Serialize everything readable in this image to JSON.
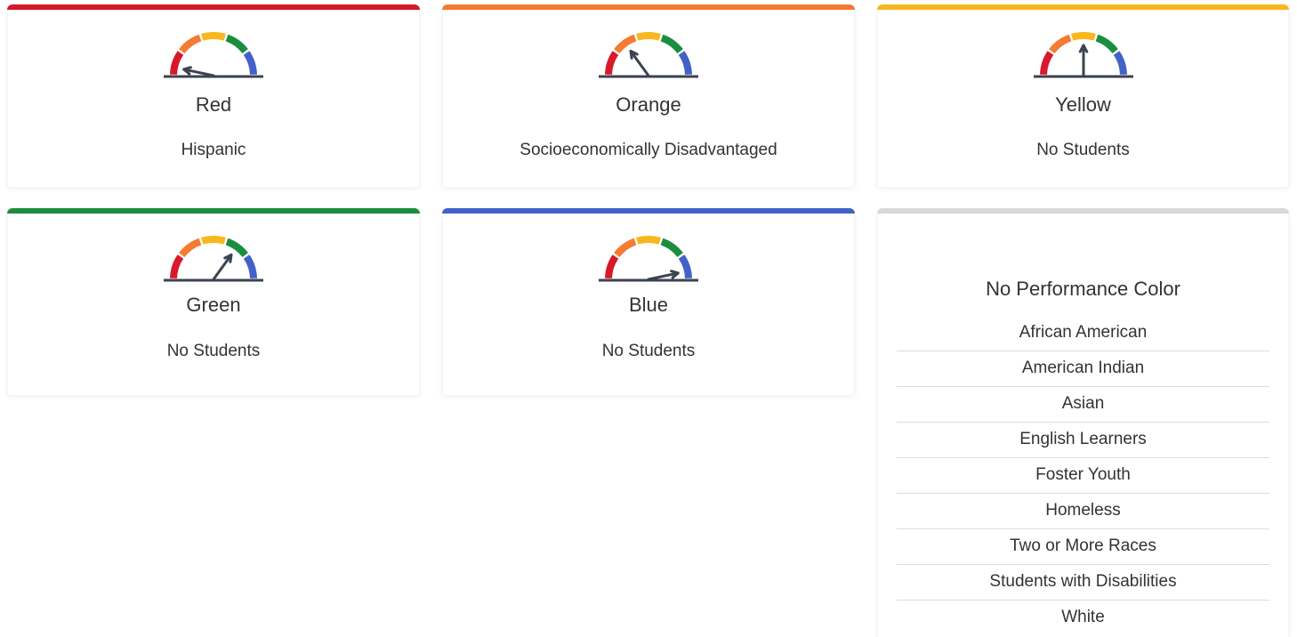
{
  "colors": {
    "red": "#d7192b",
    "orange": "#f47b30",
    "yellow": "#f8b71d",
    "green": "#1a8e3e",
    "blue": "#4361c9",
    "grey": "#d9d9d9",
    "needle": "#3b4250"
  },
  "cards": [
    {
      "id": "red",
      "color_label": "Red",
      "groups": "Hispanic",
      "level": 1
    },
    {
      "id": "orange",
      "color_label": "Orange",
      "groups": "Socioeconomically Disadvantaged",
      "level": 2
    },
    {
      "id": "yellow",
      "color_label": "Yellow",
      "groups": "No Students",
      "level": 3
    },
    {
      "id": "green",
      "color_label": "Green",
      "groups": "No Students",
      "level": 4
    },
    {
      "id": "blue",
      "color_label": "Blue",
      "groups": "No Students",
      "level": 5
    }
  ],
  "no_performance": {
    "title": "No Performance Color",
    "groups": [
      "African American",
      "American Indian",
      "Asian",
      "English Learners",
      "Foster Youth",
      "Homeless",
      "Two or More Races",
      "Students with Disabilities",
      "White"
    ]
  }
}
